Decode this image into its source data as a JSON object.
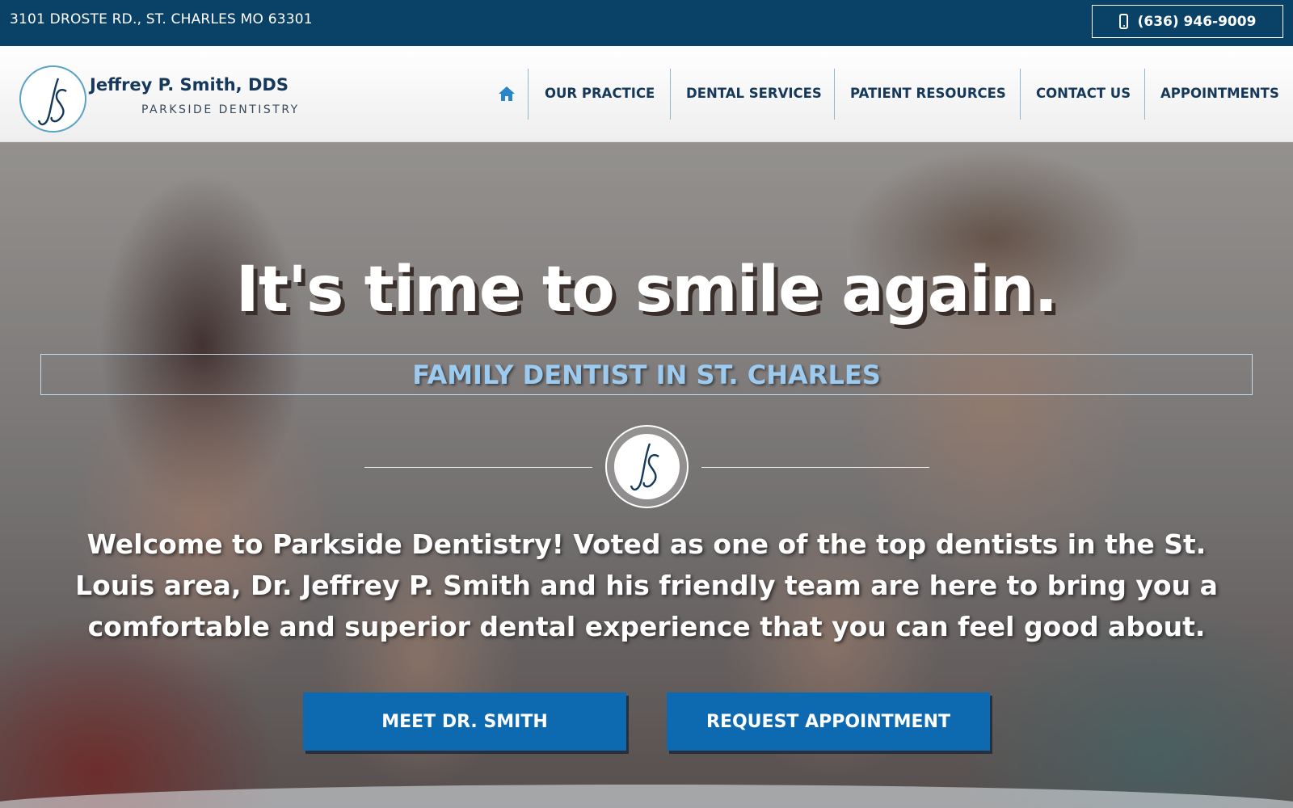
{
  "topbar": {
    "address": "3101 DROSTE RD., ST. CHARLES MO 63301",
    "phone": "(636) 946-9009"
  },
  "brand": {
    "monogram": "JS",
    "name": "Jeffrey P. Smith, DDS",
    "subtitle": "PARKSIDE DENTISTRY"
  },
  "nav": {
    "home_icon": "home-icon",
    "items": [
      {
        "label": "OUR PRACTICE"
      },
      {
        "label": "DENTAL SERVICES"
      },
      {
        "label": "PATIENT RESOURCES"
      },
      {
        "label": "CONTACT US"
      },
      {
        "label": "APPOINTMENTS"
      }
    ]
  },
  "hero": {
    "headline": "It's time to smile again.",
    "subheadline": "FAMILY DENTIST IN ST. CHARLES",
    "welcome": "Welcome to Parkside Dentistry! Voted as one of the top dentists in the St. Louis area, Dr. Jeffrey P. Smith and his friendly team are here to bring you a comfortable and superior dental experience that you can feel good about.",
    "buttons": [
      {
        "label": "MEET DR. SMITH"
      },
      {
        "label": "REQUEST APPOINTMENT"
      }
    ]
  },
  "colors": {
    "navy": "#0a4166",
    "brand_text": "#15385b",
    "accent_blue": "#0d6ab0",
    "sub_text": "#9dcbef"
  }
}
